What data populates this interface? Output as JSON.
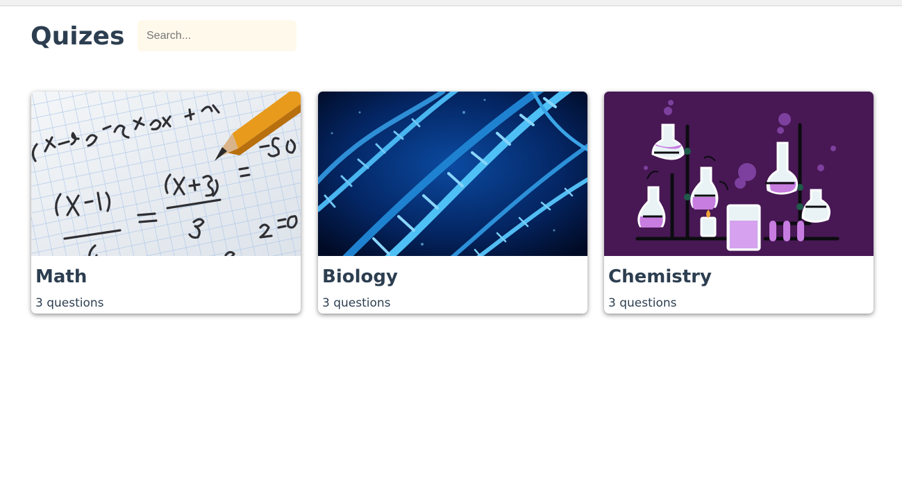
{
  "page": {
    "title": "Quizes"
  },
  "search": {
    "placeholder": "Search..."
  },
  "quizzes": [
    {
      "name": "Math",
      "count": "3 questions",
      "image": "math-notebook-image"
    },
    {
      "name": "Biology",
      "count": "3 questions",
      "image": "dna-helix-image"
    },
    {
      "name": "Chemistry",
      "count": "3 questions",
      "image": "chemistry-lab-image"
    }
  ],
  "colors": {
    "heading": "#2c3e50",
    "search_bg": "#fff9ec",
    "chemistry_bg": "#471854",
    "dna_blue": "#37a8ea",
    "pencil": "#e89a1d"
  }
}
